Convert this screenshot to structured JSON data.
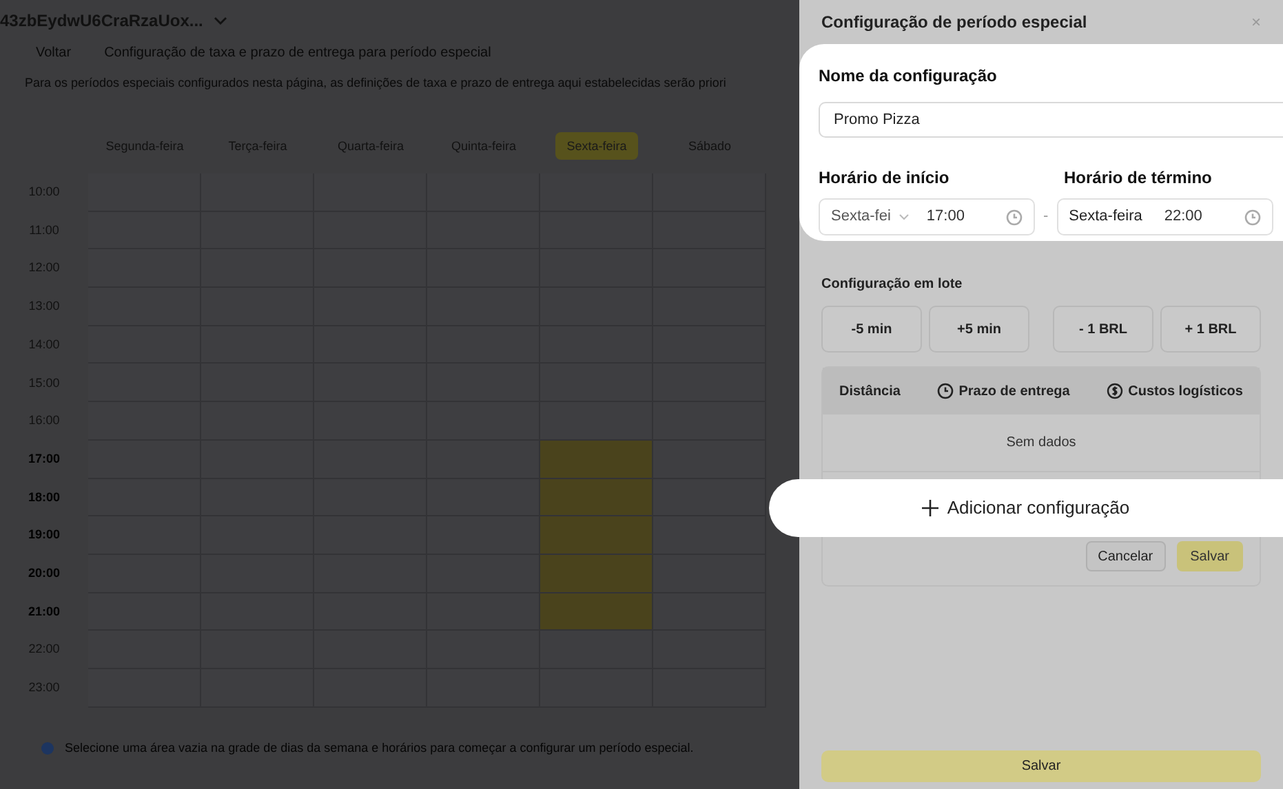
{
  "header": {
    "title": "43zbEydwU6CraRzaUox...",
    "back": "Voltar",
    "subtitle": "Configuração de taxa e prazo de entrega para período especial",
    "description": "Para os períodos especiais configurados nesta página, as definições de taxa e prazo de entrega aqui estabelecidas serão priori"
  },
  "days": [
    {
      "label": "Segunda-feira",
      "selected": false
    },
    {
      "label": "Terça-feira",
      "selected": false
    },
    {
      "label": "Quarta-feira",
      "selected": false
    },
    {
      "label": "Quinta-feira",
      "selected": false
    },
    {
      "label": "Sexta-feira",
      "selected": true
    },
    {
      "label": "Sábado",
      "selected": false
    }
  ],
  "hours": [
    {
      "label": "10:00",
      "highlighted": false
    },
    {
      "label": "11:00",
      "highlighted": false
    },
    {
      "label": "12:00",
      "highlighted": false
    },
    {
      "label": "13:00",
      "highlighted": false
    },
    {
      "label": "14:00",
      "highlighted": false
    },
    {
      "label": "15:00",
      "highlighted": false
    },
    {
      "label": "16:00",
      "highlighted": false
    },
    {
      "label": "17:00",
      "highlighted": true
    },
    {
      "label": "18:00",
      "highlighted": true
    },
    {
      "label": "19:00",
      "highlighted": true
    },
    {
      "label": "20:00",
      "highlighted": true
    },
    {
      "label": "21:00",
      "highlighted": true
    },
    {
      "label": "22:00",
      "highlighted": false
    },
    {
      "label": "23:00",
      "highlighted": false
    }
  ],
  "info": "Selecione uma área vazia na grade de dias da semana e horários para começar a configurar um período especial.",
  "panel": {
    "title": "Configuração de período especial",
    "close": "×",
    "name_label": "Nome da configuração",
    "name_value": "Promo Pizza",
    "start_label": "Horário de início",
    "start_day": "Sexta-fei",
    "start_time": "17:00",
    "separator": "-",
    "end_label": "Horário de término",
    "end_day": "Sexta-feira",
    "end_time": "22:00",
    "batch_label": "Configuração em lote",
    "batch_buttons": [
      "-5 min",
      "+5 min",
      "- 1 BRL",
      "+ 1 BRL"
    ],
    "columns": [
      {
        "label": "Distância",
        "kind": "plain"
      },
      {
        "label": "Prazo de entrega",
        "kind": "clock"
      },
      {
        "label": "Custos logísticos",
        "kind": "money"
      }
    ],
    "empty": "Sem dados",
    "add": "Adicionar configuração",
    "cancel": "Cancelar",
    "save": "Salvar",
    "footer_save": "Salvar"
  }
}
